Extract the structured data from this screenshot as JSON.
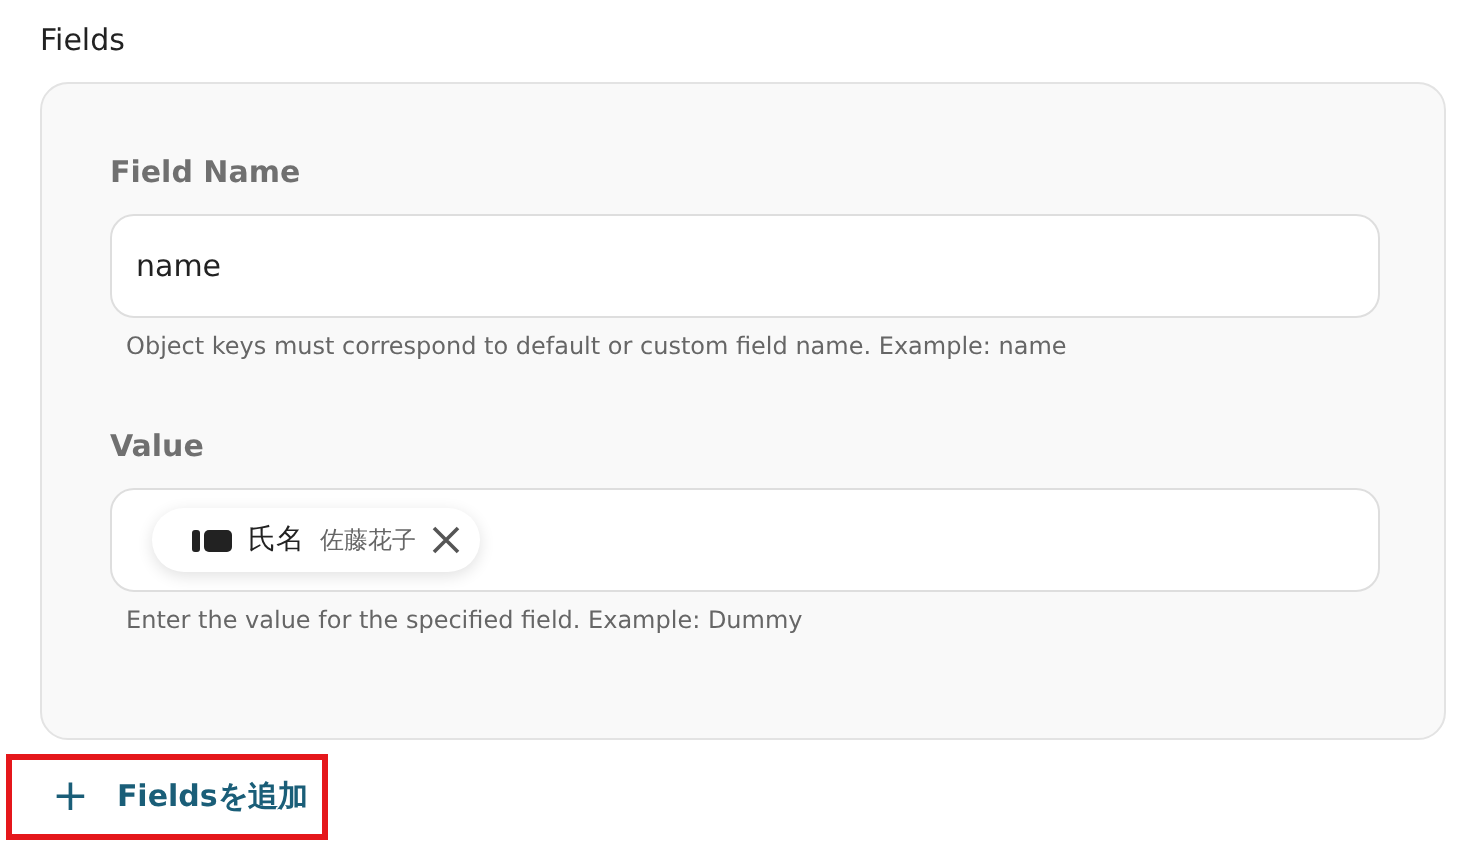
{
  "section_title": "Fields",
  "fields": [
    {
      "label": "Field Name",
      "kind": "text",
      "value": "name",
      "help": "Object keys must correspond to default or custom field name. Example: name"
    },
    {
      "label": "Value",
      "kind": "chip",
      "chip": {
        "name": "氏名",
        "sample": "佐藤花子"
      },
      "help": "Enter the value for the specified field. Example: Dummy"
    }
  ],
  "add_button": {
    "icon": "+",
    "label": "Fieldsを追加",
    "highlighted": true
  }
}
